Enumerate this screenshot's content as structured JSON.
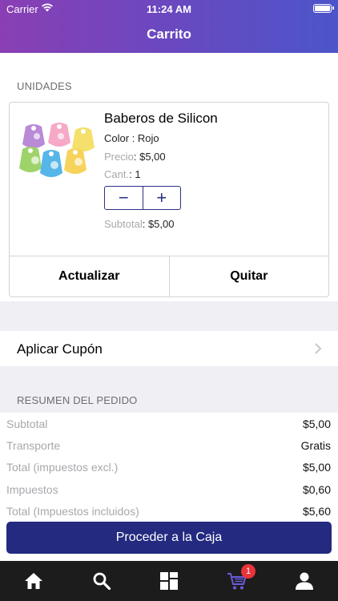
{
  "status_bar": {
    "carrier": "Carrier",
    "time": "11:24 AM"
  },
  "header": {
    "title": "Carrito"
  },
  "units_section": {
    "label": "UNIDADES"
  },
  "product": {
    "name": "Baberos de Silicon",
    "color_label": "Color",
    "color_value": "Rojo",
    "price_label": "Precio",
    "price_value": "$5,00",
    "qty_label": "Cant.",
    "qty_value": "1",
    "subtotal_label": "Subtotal",
    "subtotal_value": "$5,00",
    "minus_symbol": "−",
    "plus_symbol": "+"
  },
  "card_actions": {
    "update": "Actualizar",
    "remove": "Quitar"
  },
  "coupon": {
    "label": "Aplicar Cupón"
  },
  "summary": {
    "label": "RESUMEN DEL PEDIDO",
    "rows": [
      {
        "key": "Subtotal",
        "value": "$5,00"
      },
      {
        "key": "Transporte",
        "value": "Gratis"
      },
      {
        "key": "Total (impuestos excl.)",
        "value": "$5,00"
      },
      {
        "key": "Impuestos",
        "value": "$0,60"
      },
      {
        "key": "Total (Impuestos incluidos)",
        "value": "$5,60"
      }
    ]
  },
  "checkout": {
    "label": "Proceder a la Caja"
  },
  "tabbar": {
    "items": [
      {
        "icon": "home-icon"
      },
      {
        "icon": "search-icon"
      },
      {
        "icon": "categories-icon"
      },
      {
        "icon": "cart-icon",
        "active": true
      },
      {
        "icon": "profile-icon"
      }
    ],
    "cart_badge": "1",
    "active_color": "#6a5cdc",
    "inactive_color": "#ffffff"
  },
  "colors": {
    "accent": "#232a80",
    "badge": "#e8343a"
  }
}
